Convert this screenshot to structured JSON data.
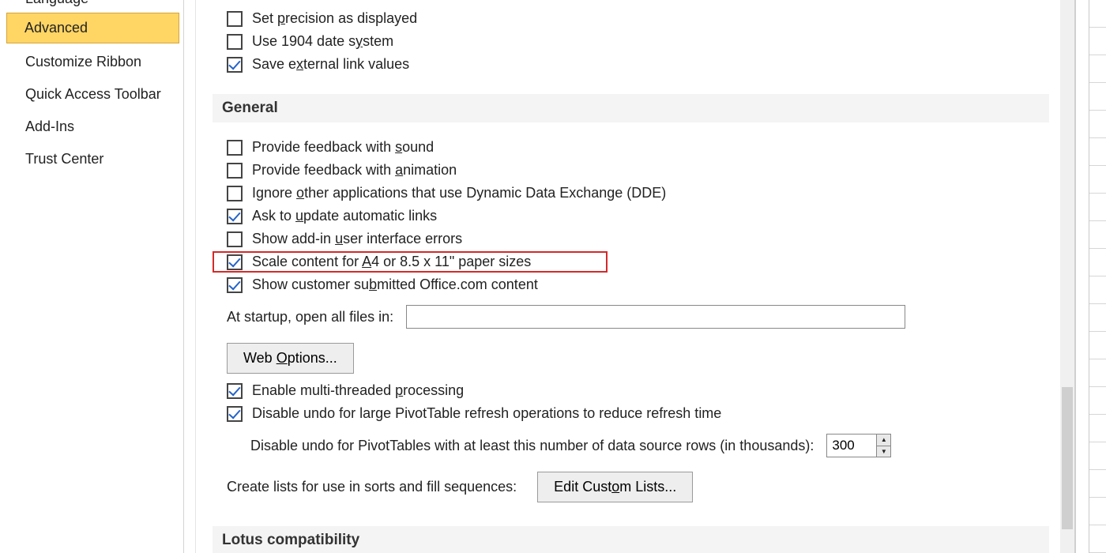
{
  "sidebar": {
    "items": [
      {
        "label": "Language"
      },
      {
        "label": "Advanced",
        "selected": true
      },
      {
        "label": "Customize Ribbon"
      },
      {
        "label": "Quick Access Toolbar"
      },
      {
        "label": "Add-Ins"
      },
      {
        "label": "Trust Center"
      }
    ]
  },
  "sections": {
    "calc": {
      "precision": {
        "pre": "Set ",
        "u": "p",
        "post": "recision as displayed",
        "checked": false
      },
      "date1904": {
        "pre": "Use 1904 date s",
        "u": "y",
        "post": "stem",
        "checked": false
      },
      "extlinks": {
        "pre": "Save e",
        "u": "x",
        "post": "ternal link values",
        "checked": true
      }
    },
    "general": {
      "header": "General",
      "sound": {
        "pre": "Provide feedback with ",
        "u": "s",
        "post": "ound",
        "checked": false
      },
      "anim": {
        "pre": "Provide feedback with ",
        "u": "a",
        "post": "nimation",
        "checked": false
      },
      "dde": {
        "pre": "Ignore ",
        "u": "o",
        "post": "ther applications that use Dynamic Data Exchange (DDE)",
        "checked": false
      },
      "ask": {
        "pre": "Ask to ",
        "u": "u",
        "post": "pdate automatic links",
        "checked": true
      },
      "addinerr": {
        "pre": "Show add-in ",
        "u": "u",
        "post": "ser interface errors",
        "checked": false
      },
      "a4": {
        "pre": "Scale content for ",
        "u": "A",
        "post": "4 or 8.5 x 11\" paper sizes",
        "checked": true,
        "highlight": true
      },
      "custsub": {
        "pre": "Show customer su",
        "u": "b",
        "post": "mitted Office.com content",
        "checked": true
      },
      "startup_label": "At startup, open all files in:",
      "startup_value": "",
      "weboptions": {
        "pre": "Web ",
        "u": "O",
        "post": "ptions..."
      },
      "multithread": {
        "pre": "Enable multi-threaded ",
        "u": "p",
        "post": "rocessing",
        "checked": true
      },
      "pivotundo": {
        "text": "Disable undo for large PivotTable refresh operations to reduce refresh time",
        "checked": true
      },
      "pivot_thresh_label": "Disable undo for PivotTables with at least this number of data source rows (in thousands):",
      "pivot_thresh_value": "300",
      "sortlists_label": "Create lists for use in sorts and fill sequences:",
      "editlists": {
        "pre": "Edit Cust",
        "u": "o",
        "post": "m Lists..."
      }
    },
    "lotus": {
      "header": "Lotus compatibility"
    }
  }
}
